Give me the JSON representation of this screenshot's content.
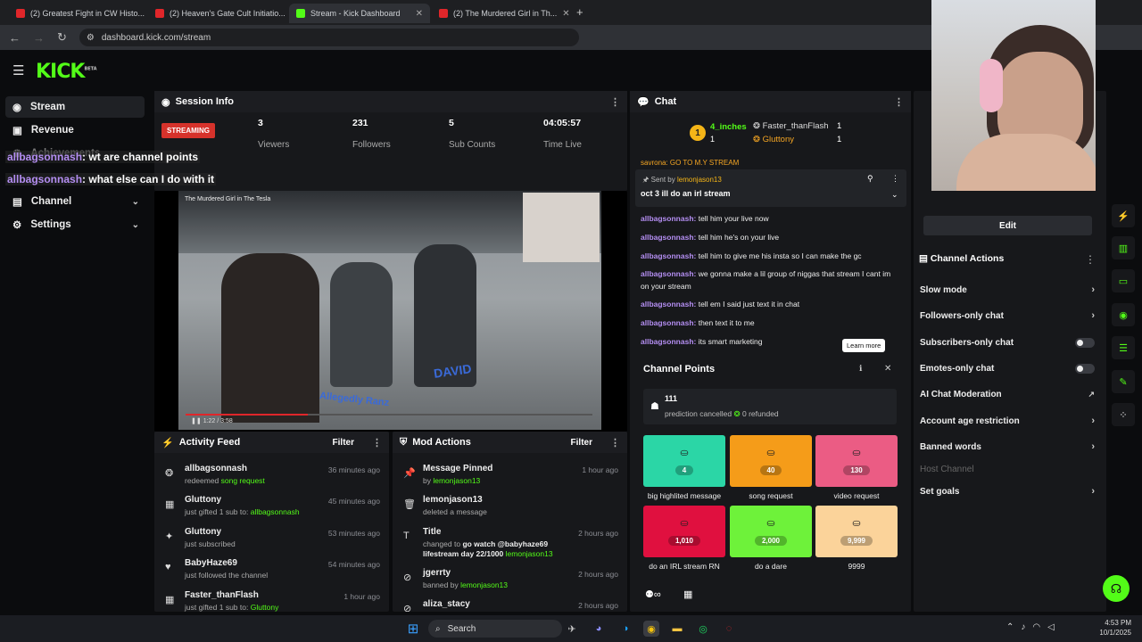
{
  "browser": {
    "tabs": [
      {
        "title": "(2) Greatest Fight in CW Histo...",
        "color": "#e0262a"
      },
      {
        "title": "(2) Heaven's Gate Cult Initiatio...",
        "color": "#e0262a"
      },
      {
        "title": "Stream - Kick Dashboard",
        "color": "#53fc18"
      },
      {
        "title": "(2) The Murdered Girl in Th...",
        "color": "#e0262a"
      }
    ],
    "url": "dashboard.kick.com/stream",
    "new_tab": "+"
  },
  "brand": {
    "logo": "KICK",
    "beta": "BETA",
    "accent": "#53fc18"
  },
  "sidebar": {
    "items": [
      {
        "label": "Stream",
        "icon": "broadcast-icon"
      },
      {
        "label": "Revenue",
        "icon": "dollar-icon"
      },
      {
        "label": "Achievements",
        "icon": "trophy-icon"
      },
      {
        "label": "Channel",
        "icon": "user-icon"
      },
      {
        "label": "Settings",
        "icon": "gear-icon"
      }
    ]
  },
  "overlay_chat": [
    {
      "user": "allbagsonnash",
      "text": ": wt are channel points"
    },
    {
      "user": "allbagsonnash",
      "text": ": what else can I do with it"
    }
  ],
  "session": {
    "title": "Session Info",
    "status": "STREAMING",
    "stats": [
      {
        "value": "3",
        "label": "Viewers"
      },
      {
        "value": "231",
        "label": "Followers"
      },
      {
        "value": "5",
        "label": "Sub Counts"
      },
      {
        "value": "04:05:57",
        "label": "Time Live"
      }
    ],
    "video_title": "The Murdered Girl in The Tesla",
    "video_time": "1:22 / 3:58",
    "video_text1": "Allegedly Ranz",
    "video_text2": "DAVID",
    "video_progress": 0.3
  },
  "activity": {
    "title": "Activity Feed",
    "filter": "Filter",
    "rows": [
      {
        "name": "allbagsonnash",
        "pre": "redeemed ",
        "hl": "song request",
        "time": "36 minutes ago",
        "icon": "points-icon"
      },
      {
        "name": "Gluttony",
        "pre": "just gifted 1 sub to: ",
        "hl": "allbagsonnash",
        "time": "45 minutes ago",
        "icon": "gift-icon"
      },
      {
        "name": "Gluttony",
        "pre": "just subscribed",
        "hl": "",
        "time": "53 minutes ago",
        "icon": "star-icon"
      },
      {
        "name": "BabyHaze69",
        "pre": "just followed the channel",
        "hl": "",
        "time": "54 minutes ago",
        "icon": "heart-icon"
      },
      {
        "name": "Faster_thanFlash",
        "pre": "just gifted 1 sub to: ",
        "hl": "Gluttony",
        "time": "1 hour ago",
        "icon": "gift-icon"
      }
    ]
  },
  "mod": {
    "title": "Mod Actions",
    "filter": "Filter",
    "rows": [
      {
        "name": "Message Pinned",
        "pre": "by ",
        "hl": "lemonjason13",
        "time": "1 hour ago",
        "icon": "pin-icon"
      },
      {
        "name": "lemonjason13",
        "pre": "deleted a message",
        "hl": "",
        "time": "",
        "icon": "trash-icon"
      },
      {
        "name": "Title",
        "pre": "changed to ",
        "hl": "go watch @babyhaze69 lifestream day 22/1000",
        "hl2": "lemonjason13",
        "time": "2 hours ago",
        "icon": "text-icon"
      },
      {
        "name": "jgerrty",
        "pre": "banned by ",
        "hl": "lemonjason13",
        "time": "2 hours ago",
        "icon": "ban-icon"
      },
      {
        "name": "aliza_stacy",
        "pre": "",
        "hl": "",
        "time": "2 hours ago",
        "icon": "ban-icon"
      }
    ]
  },
  "chat": {
    "title": "Chat",
    "leaders": [
      {
        "rank": "1",
        "name": "4_inches",
        "count": "1"
      },
      {
        "name": "Faster_thanFlash",
        "count": "1"
      },
      {
        "name": "Gluttony",
        "count": "1"
      }
    ],
    "partial_top": "savrona: GO TO M.Y STREAM",
    "pinned": {
      "label": "Sent by",
      "user": "lemonjason13",
      "text": "oct 3 ill do an irl stream"
    },
    "messages": [
      {
        "user": "allbagsonnash:",
        "text": "tell him your live now"
      },
      {
        "user": "allbagsonnash:",
        "text": "tell him he's on your live"
      },
      {
        "user": "allbagsonnash:",
        "text": "tell him to give me his insta so I can make the gc"
      },
      {
        "user": "allbagsonnash:",
        "text": "we gonna make a lil group of niggas that stream I cant im on your stream"
      },
      {
        "user": "allbagsonnash:",
        "text": "tell em I said just text it in chat"
      },
      {
        "user": "allbagsonnash:",
        "text": "then text it to me"
      },
      {
        "user": "allbagsonnash:",
        "text": "its smart marketing"
      }
    ],
    "learn_more": "Learn more"
  },
  "channel_points": {
    "title": "Channel Points",
    "notice_count": "111",
    "notice_text": "prediction cancelled",
    "refund_text": "0 refunded",
    "rewards": [
      {
        "cost": "4",
        "label": "big highlited message",
        "color": "#2bd6a6"
      },
      {
        "cost": "40",
        "label": "song request",
        "color": "#f59c19"
      },
      {
        "cost": "130",
        "label": "video request",
        "color": "#eb5c84"
      },
      {
        "cost": "1,010",
        "label": "do an IRL stream RN",
        "color": "#e0103f"
      },
      {
        "cost": "2,000",
        "label": "do a dare",
        "color": "#6ef23a"
      },
      {
        "cost": "9,999",
        "label": "9999",
        "color": "#fbd39a"
      }
    ]
  },
  "right": {
    "edit": "Edit",
    "actions_title": "Channel Actions",
    "actions": [
      {
        "label": "Slow mode",
        "ctrl": "chevron"
      },
      {
        "label": "Followers-only chat",
        "ctrl": "chevron"
      },
      {
        "label": "Subscribers-only chat",
        "ctrl": "toggle"
      },
      {
        "label": "Emotes-only chat",
        "ctrl": "toggle"
      },
      {
        "label": "AI Chat Moderation",
        "ctrl": "external"
      },
      {
        "label": "Account age restriction",
        "ctrl": "chevron"
      },
      {
        "label": "Banned words",
        "ctrl": "chevron"
      },
      {
        "label": "Host Channel",
        "ctrl": "none"
      },
      {
        "label": "Set goals",
        "ctrl": "chevron"
      }
    ]
  },
  "taskbar": {
    "search": "Search",
    "time": "4:53 PM",
    "date": "10/1/2025"
  }
}
